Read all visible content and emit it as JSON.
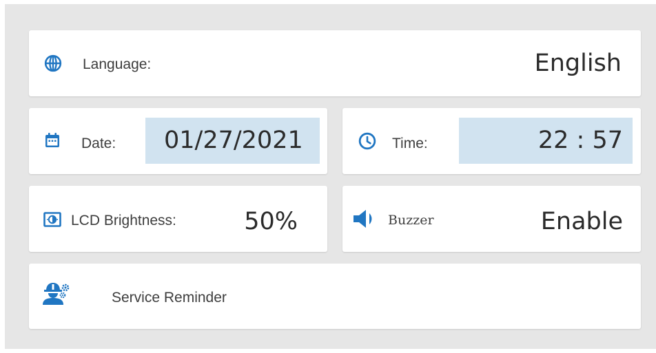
{
  "colors": {
    "accent": "#2076c2",
    "background": "#e6e6e6",
    "card": "#ffffff",
    "value_highlight": "#d1e3f0"
  },
  "language": {
    "icon": "globe-icon",
    "label": "Language:",
    "value": "English"
  },
  "date": {
    "icon": "calendar-icon",
    "label": "Date:",
    "value": "01/27/2021"
  },
  "time": {
    "icon": "clock-icon",
    "label": "Time:",
    "value": "22 : 57"
  },
  "brightness": {
    "icon": "brightness-icon",
    "label": "LCD Brightness:",
    "value": "50%"
  },
  "buzzer": {
    "icon": "speaker-icon",
    "label": "Buzzer",
    "value": "Enable"
  },
  "service": {
    "icon": "service-worker-icon",
    "label": "Service Reminder"
  }
}
